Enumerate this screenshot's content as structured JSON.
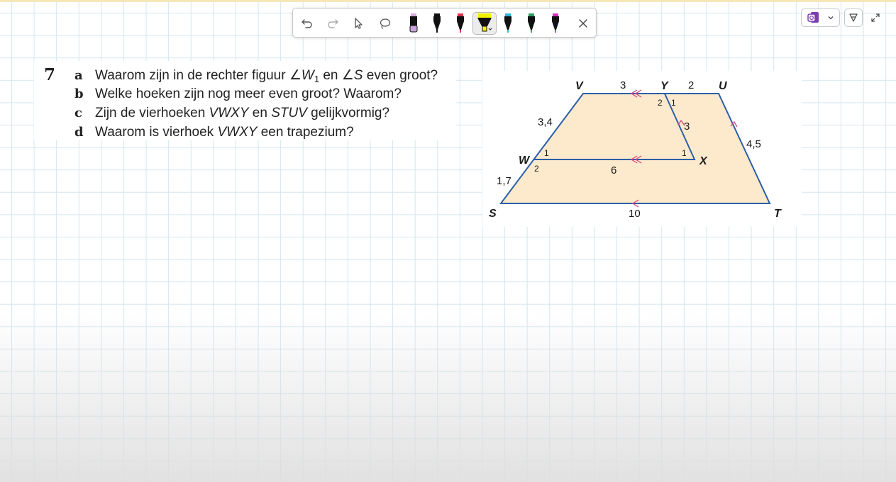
{
  "toolbar": {
    "tools": [
      {
        "name": "undo-button",
        "icon": "undo-icon"
      },
      {
        "name": "redo-button",
        "icon": "redo-icon"
      },
      {
        "name": "select-tool",
        "icon": "pointer-icon"
      },
      {
        "name": "lasso-tool",
        "icon": "lasso-icon"
      },
      {
        "name": "pen-purple",
        "color": "#c9a2d9"
      },
      {
        "name": "pen-black",
        "color": "#111111"
      },
      {
        "name": "pen-red",
        "color": "#e0304a"
      },
      {
        "name": "highlighter-yellow",
        "color": "#f5f000",
        "selected": true
      },
      {
        "name": "pen-cyan",
        "color": "#2fb6d6"
      },
      {
        "name": "pen-green",
        "color": "#2f9e5e"
      },
      {
        "name": "pen-magenta",
        "color": "#d630c0"
      },
      {
        "name": "close-button",
        "icon": "close-icon"
      }
    ]
  },
  "exercise": {
    "number": "7",
    "questions": [
      {
        "letter": "a",
        "parts": [
          "Waarom zijn in de rechter figuur ∠",
          "W",
          "1",
          " en ∠",
          "S",
          " even groot?"
        ]
      },
      {
        "letter": "b",
        "text": "Welke hoeken zijn nog meer even groot? Waarom?"
      },
      {
        "letter": "c",
        "parts": [
          "Zijn de vierhoeken ",
          "VWXY",
          " en ",
          "STUV",
          " gelijkvormig?"
        ]
      },
      {
        "letter": "d",
        "parts": [
          "Waarom is vierhoek ",
          "VWXY",
          " een trapezium?"
        ]
      }
    ]
  },
  "figure": {
    "vertices": {
      "V": "V",
      "Y": "Y",
      "U": "U",
      "W": "W",
      "X": "X",
      "S": "S",
      "T": "T"
    },
    "measures": {
      "VY": "3",
      "YU": "2",
      "VW": "3,4",
      "WS": "1,7",
      "WX": "6",
      "YX": "3",
      "UT": "4,5",
      "ST": "10"
    },
    "angles": {
      "Y2": "2",
      "Y1": "1",
      "W1": "1",
      "W2": "2",
      "X1": "1"
    },
    "fill_color": "#fde9cc",
    "line_color": "#2a5fa8",
    "arrow_color": "#d8457a"
  }
}
